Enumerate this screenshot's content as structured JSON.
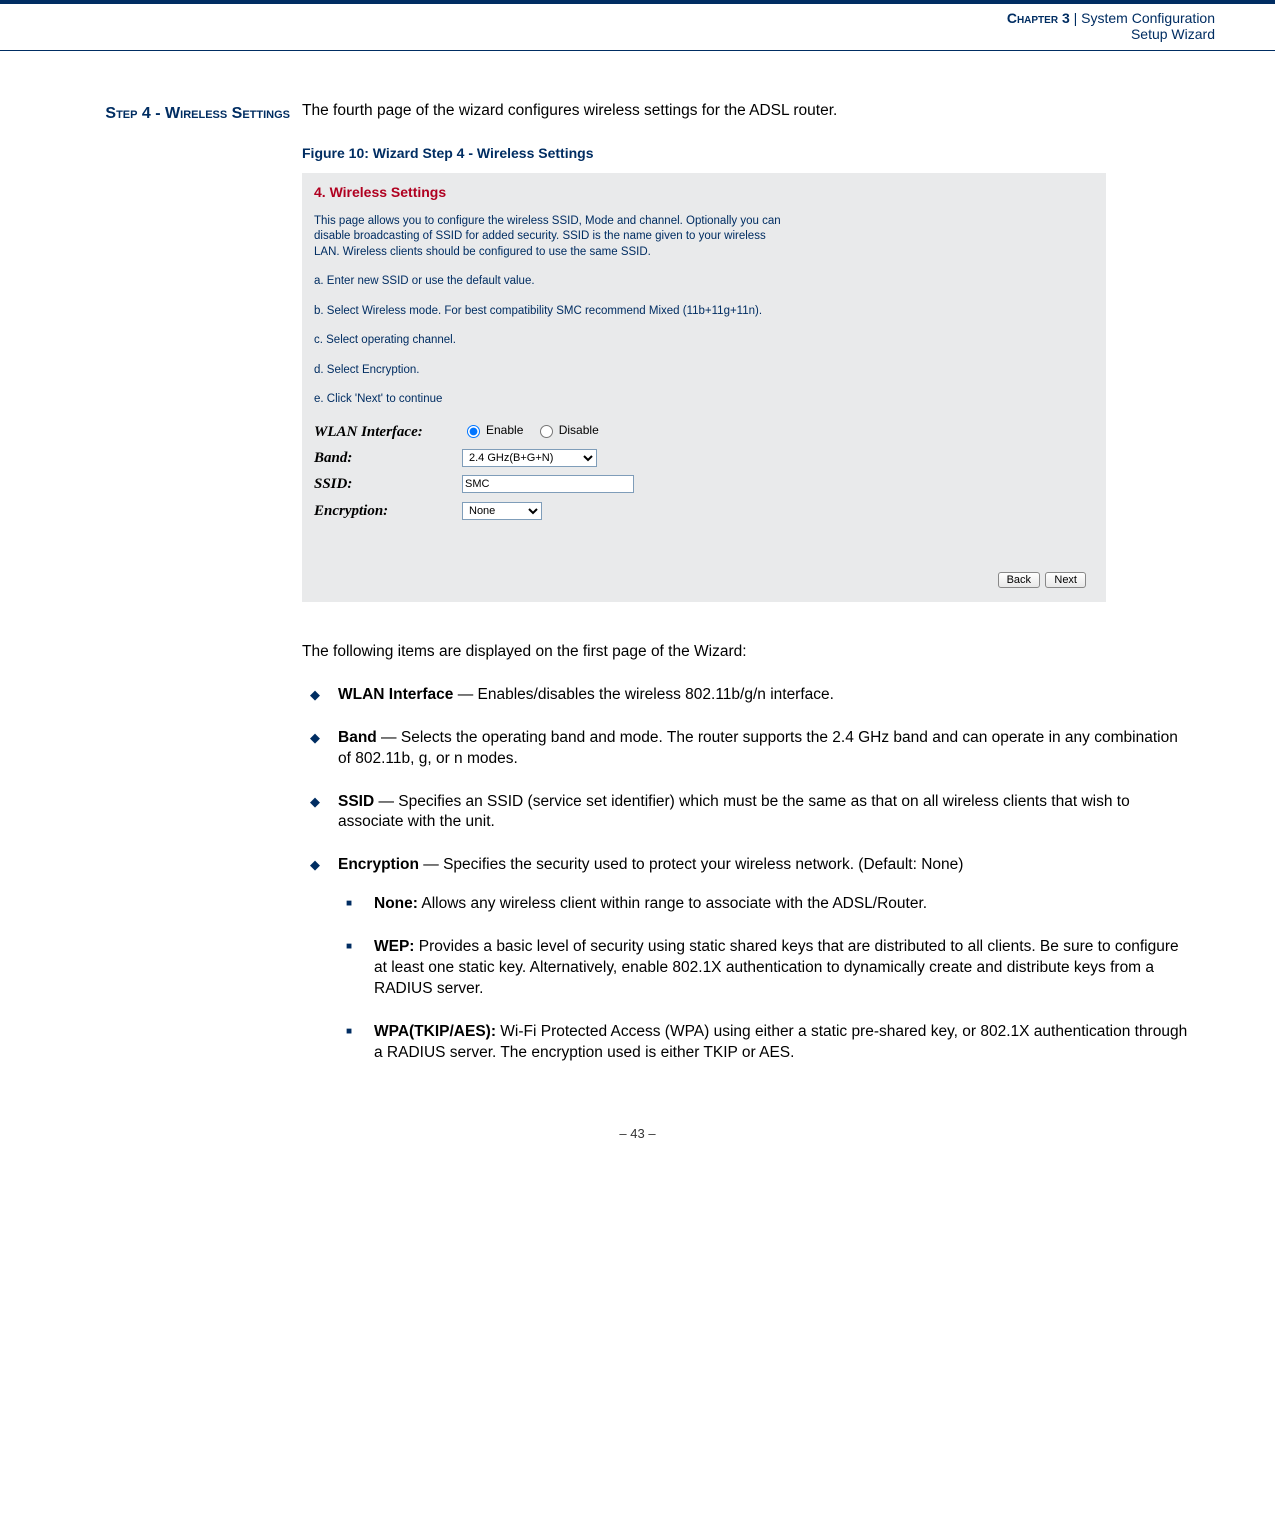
{
  "header": {
    "chapter_label": "Chapter 3",
    "separator": "  |  ",
    "chapter_title": "System Configuration",
    "subtitle": "Setup Wizard"
  },
  "side_heading": "Step 4 - Wireless Settings",
  "intro": "The fourth page of the wizard configures wireless settings for the ADSL router.",
  "figure_caption": "Figure 10:  Wizard Step 4 - Wireless Settings",
  "screenshot": {
    "title": "4. Wireless Settings",
    "para_main": "This page allows you to configure the wireless SSID, Mode and channel. Optionally you can disable broadcasting of SSID for added security. SSID is the name given to your wireless LAN. Wireless clients should be configured to use the same SSID.",
    "para_a": "a. Enter new SSID or use the default value.",
    "para_b": "b. Select Wireless mode. For best compatibility SMC recommend Mixed (11b+11g+11n).",
    "para_c": "c. Select operating channel.",
    "para_d": "d. Select Encryption.",
    "para_e": "e. Click 'Next' to continue",
    "labels": {
      "wlan": "WLAN Interface:",
      "band": "Band:",
      "ssid": "SSID:",
      "encryption": "Encryption:"
    },
    "wlan_enable": "Enable",
    "wlan_disable": "Disable",
    "band_value": "2.4 GHz(B+G+N)",
    "ssid_value": "SMC",
    "encryption_value": "None",
    "back_btn": "Back",
    "next_btn": "Next"
  },
  "lead": "The following items are displayed on the first page of the Wizard:",
  "items": [
    {
      "term": "WLAN Interface",
      "desc": " — Enables/disables the wireless 802.11b/g/n interface."
    },
    {
      "term": "Band",
      "desc": " — Selects the operating band and mode. The router supports the 2.4 GHz band and can operate in any combination of 802.11b, g, or n modes."
    },
    {
      "term": "SSID",
      "desc": " — Specifies an SSID (service set identifier) which must be the same as that on all wireless clients that wish to associate with the unit."
    },
    {
      "term": "Encryption",
      "desc": " — Specifies the security used to protect your wireless network. (Default: None)"
    }
  ],
  "sub_items": [
    {
      "term": "None:",
      "desc": " Allows any wireless client within range to associate with the ADSL/Router."
    },
    {
      "term": "WEP:",
      "desc": " Provides a basic level of security using static shared keys that are distributed to all clients. Be sure to configure at least one static key. Alternatively, enable 802.1X authentication to dynamically create and distribute keys from a RADIUS server."
    },
    {
      "term": "WPA(TKIP/AES):",
      "desc": " Wi-Fi Protected Access (WPA) using either a static pre-shared key, or 802.1X authentication through a RADIUS server. The encryption used is either TKIP or AES."
    }
  ],
  "page_number": "–  43  –"
}
